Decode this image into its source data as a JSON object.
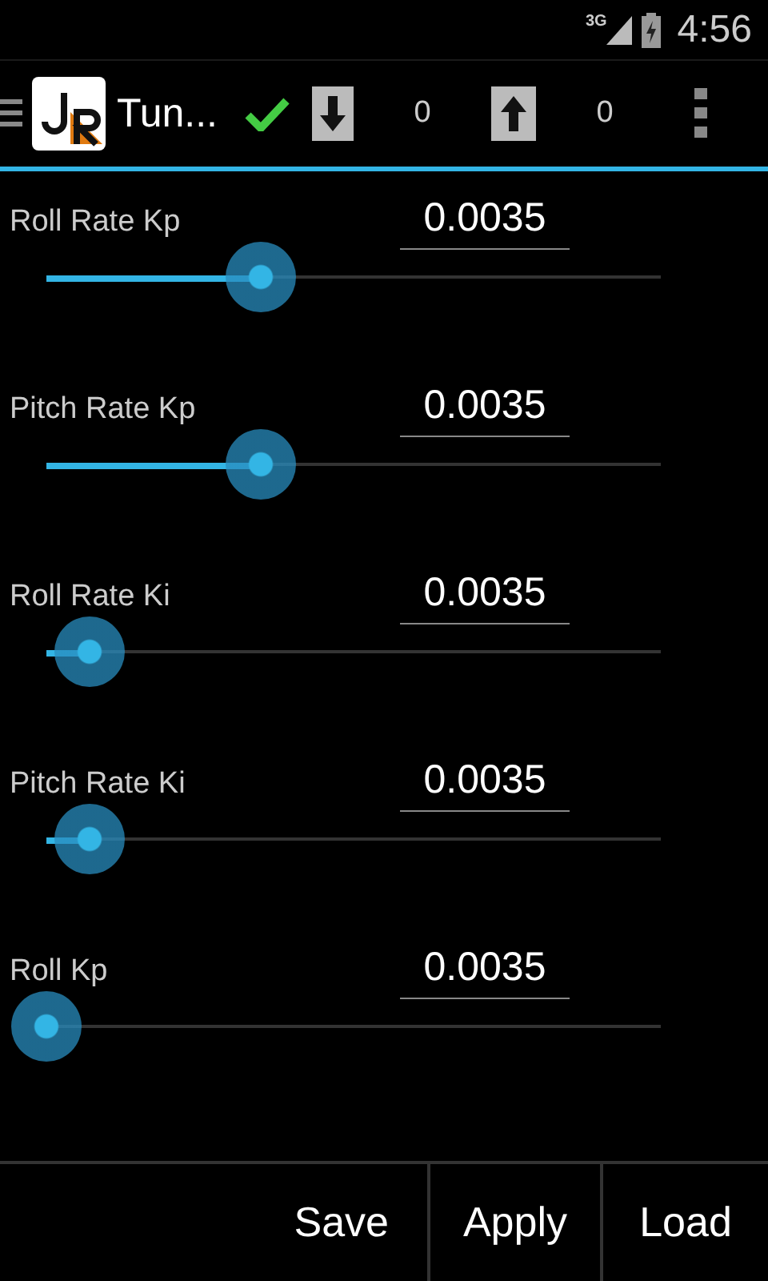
{
  "status_bar": {
    "network": "3G",
    "time": "4:56"
  },
  "action_bar": {
    "title": "Tun...",
    "downloads": "0",
    "uploads": "0"
  },
  "params": [
    {
      "label": "Roll Rate Kp",
      "value": "0.0035",
      "level": 0.35
    },
    {
      "label": "Pitch Rate Kp",
      "value": "0.0035",
      "level": 0.35
    },
    {
      "label": "Roll Rate Ki",
      "value": "0.0035",
      "level": 0.07
    },
    {
      "label": "Pitch Rate Ki",
      "value": "0.0035",
      "level": 0.07
    },
    {
      "label": "Roll Kp",
      "value": "0.0035",
      "level": 0
    }
  ],
  "buttons": [
    "Save",
    "Apply",
    "Load"
  ]
}
